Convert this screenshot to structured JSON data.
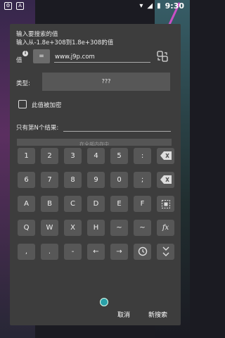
{
  "status": {
    "time": "9:30",
    "left_icons": [
      "settings-notification-icon",
      "app-a-icon"
    ],
    "right_icons": [
      "wifi-icon",
      "signal-icon",
      "battery-icon"
    ]
  },
  "dialog": {
    "line1": "输入要搜索的值",
    "line2": "输入从-1.8e+308到1.8e+308的值",
    "value_label": "值",
    "info_badge": "i",
    "eq_operator": "=",
    "address_value": "www.j9p.com",
    "type_label": "类型:",
    "type_value": "???",
    "encrypted_label": "此值被加密",
    "nth_label": "只有第N个结果:",
    "nth_value": "",
    "hidden_button_label": "在全部内存中"
  },
  "keypad": {
    "rows": [
      [
        "1",
        "2",
        "3",
        "4",
        "5",
        ":",
        "⌫"
      ],
      [
        "6",
        "7",
        "8",
        "9",
        "0",
        ";",
        "⌫"
      ],
      [
        "A",
        "B",
        "C",
        "D",
        "E",
        "F",
        "⊡"
      ],
      [
        "Q",
        "W",
        "X",
        "H",
        "~",
        "~",
        "fx"
      ],
      [
        ",",
        ".",
        "-",
        "←",
        "→",
        "⟲",
        "⌄"
      ]
    ]
  },
  "actions": {
    "cancel": "取消",
    "new_search": "新搜索"
  },
  "colors": {
    "dialog": "#3d3d3d",
    "key": "#575757",
    "handle": "#2aa0a8"
  }
}
